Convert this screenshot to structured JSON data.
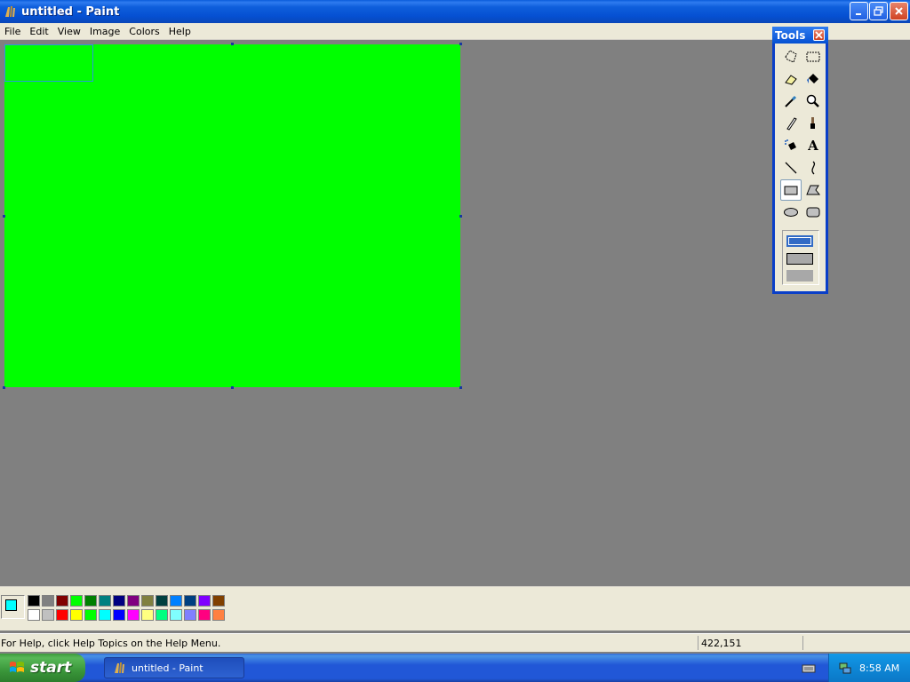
{
  "window": {
    "title": "untitled - Paint"
  },
  "menu": {
    "items": [
      "File",
      "Edit",
      "View",
      "Image",
      "Colors",
      "Help"
    ]
  },
  "tools_window": {
    "title": "Tools",
    "tools": [
      {
        "name": "free-form-select-icon"
      },
      {
        "name": "select-icon"
      },
      {
        "name": "eraser-icon"
      },
      {
        "name": "fill-icon"
      },
      {
        "name": "pick-color-icon"
      },
      {
        "name": "magnifier-icon"
      },
      {
        "name": "pencil-icon"
      },
      {
        "name": "brush-icon"
      },
      {
        "name": "airbrush-icon"
      },
      {
        "name": "text-icon",
        "glyph": "A"
      },
      {
        "name": "line-icon"
      },
      {
        "name": "curve-icon"
      },
      {
        "name": "rectangle-icon",
        "active": true
      },
      {
        "name": "polygon-icon"
      },
      {
        "name": "ellipse-icon"
      },
      {
        "name": "rounded-rectangle-icon"
      }
    ]
  },
  "palette": {
    "foreground": "#00ffff",
    "background": "#ffffff",
    "top_row": [
      "#000000",
      "#808080",
      "#800000",
      "#00ff00",
      "#008000",
      "#008080",
      "#000080",
      "#800080",
      "#808040",
      "#004040",
      "#0080ff",
      "#004080",
      "#8000ff",
      "#804000"
    ],
    "bottom_row": [
      "#ffffff",
      "#c0c0c0",
      "#ff0000",
      "#ffff00",
      "#00ff00",
      "#00ffff",
      "#0000ff",
      "#ff00ff",
      "#ffff80",
      "#00ff80",
      "#80ffff",
      "#8080ff",
      "#ff0080",
      "#ff8040"
    ]
  },
  "canvas": {
    "fill_color": "#00ff00"
  },
  "status": {
    "help_text": "For Help, click Help Topics on the Help Menu.",
    "coordinates": "422,151"
  },
  "taskbar": {
    "start_label": "start",
    "task_label": "untitled - Paint",
    "clock": "8:58 AM"
  }
}
